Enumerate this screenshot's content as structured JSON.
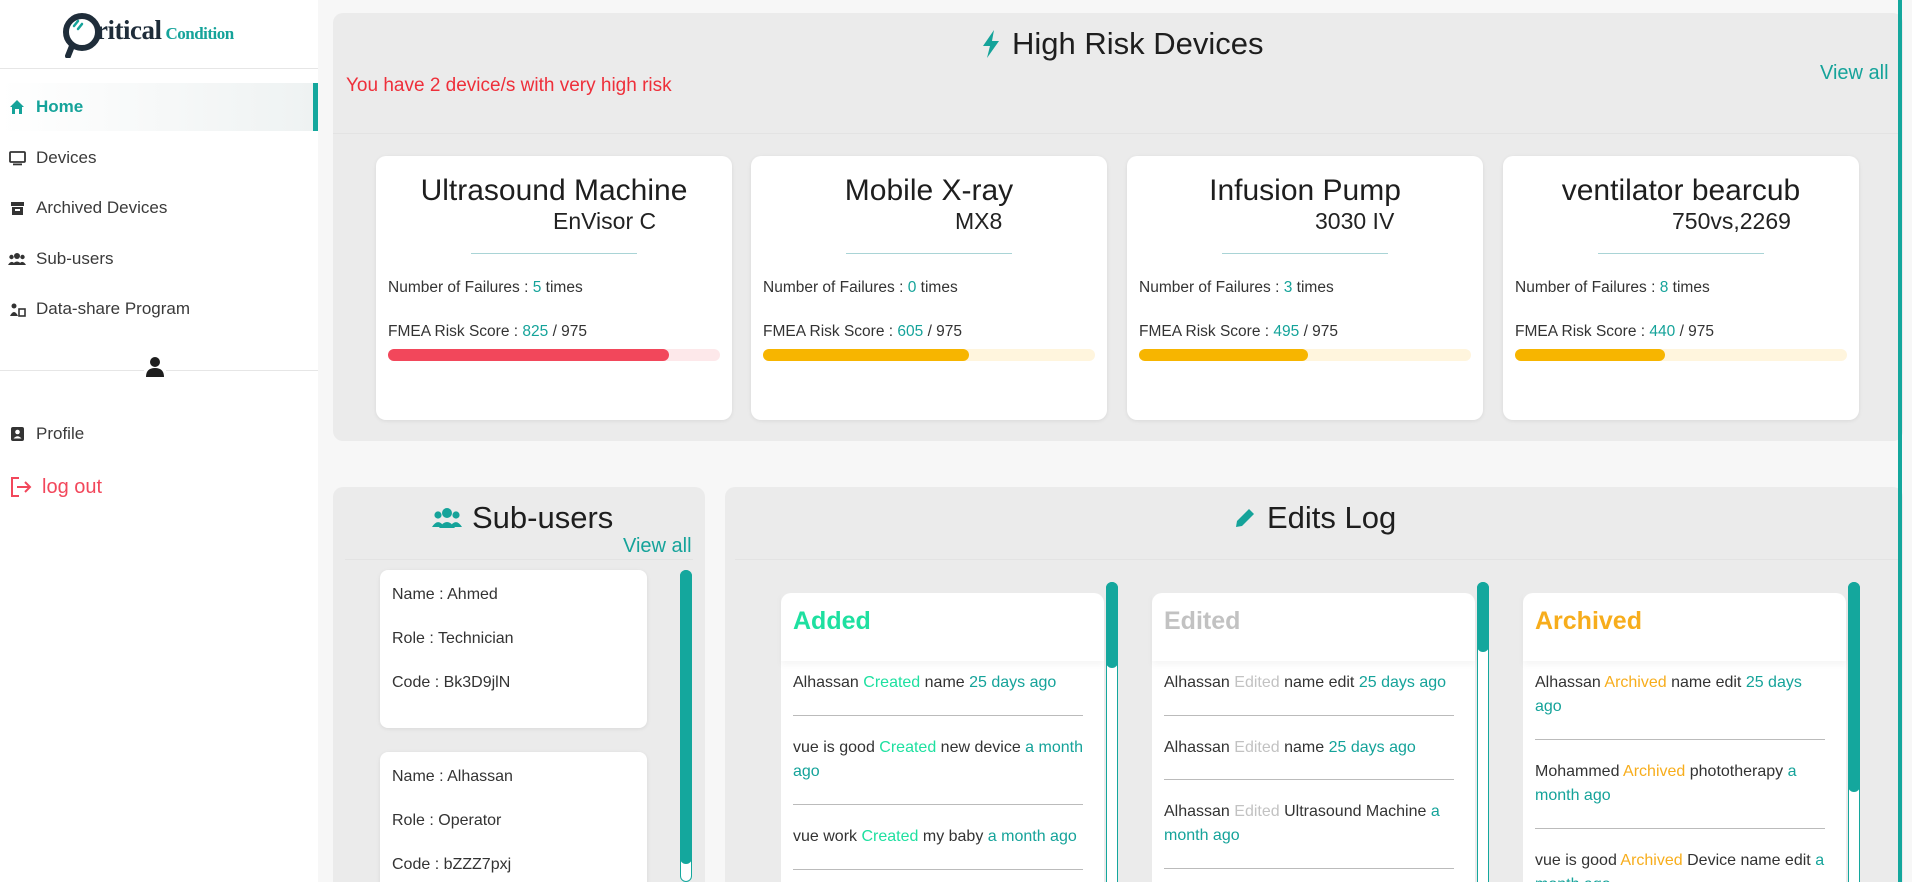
{
  "brand": {
    "name_main": "ritical",
    "name_sub": "Condition"
  },
  "sidebar": {
    "items": [
      {
        "label": "Home",
        "icon": "home-icon"
      },
      {
        "label": "Devices",
        "icon": "monitor-icon"
      },
      {
        "label": "Archived Devices",
        "icon": "archive-icon"
      },
      {
        "label": "Sub-users",
        "icon": "users-icon"
      },
      {
        "label": "Data-share Program",
        "icon": "share-icon"
      }
    ],
    "profile": "Profile",
    "logout": "log out"
  },
  "high_risk": {
    "title": "High Risk Devices",
    "alert": "You have 2 device/s with very high risk",
    "view_all": "View all",
    "failures_label": "Number of Failures : ",
    "times": "times",
    "risk_label": "FMEA Risk Score : ",
    "risk_max": "/ 975",
    "devices": [
      {
        "name": "Ultrasound Machine",
        "model": "EnVisor C",
        "failures": "5",
        "score": "825",
        "fraction": 0.846,
        "color": "#f2475b",
        "track": "#fde8ea"
      },
      {
        "name": "Mobile X-ray",
        "model": "MX8",
        "failures": "0",
        "score": "605",
        "fraction": 0.62,
        "color": "#f7b500",
        "track": "#fff5dd"
      },
      {
        "name": "Infusion Pump",
        "model": "3030 IV",
        "failures": "3",
        "score": "495",
        "fraction": 0.508,
        "color": "#f7b500",
        "track": "#fff5dd"
      },
      {
        "name": "ventilator bearcub",
        "model": "750vs,2269",
        "failures": "8",
        "score": "440",
        "fraction": 0.451,
        "color": "#f7b500",
        "track": "#fff5dd"
      }
    ]
  },
  "subusers": {
    "title": "Sub-users",
    "view_all": "View all",
    "users": [
      {
        "name": "Name : Ahmed",
        "role": "Role : Technician",
        "code": "Code : Bk3D9jlN"
      },
      {
        "name": "Name : Alhassan",
        "role": "Role : Operator",
        "code": "Code : bZZZ7pxj"
      }
    ]
  },
  "edits_log": {
    "title": "Edits Log",
    "columns": [
      {
        "title": "Added",
        "color": "#1ee0a0",
        "entries": [
          {
            "who": "Alhassan",
            "action": "Created",
            "what": "name",
            "when": "25 days ago"
          },
          {
            "who": "vue is good",
            "action": "Created",
            "what": "new device",
            "when": "a month ago"
          },
          {
            "who": "vue work",
            "action": "Created",
            "what": "my baby",
            "when": "a month ago"
          }
        ]
      },
      {
        "title": "Edited",
        "color": "#c2c2c2",
        "entries": [
          {
            "who": "Alhassan",
            "action": "Edited",
            "what": "name edit",
            "when": "25 days ago"
          },
          {
            "who": "Alhassan",
            "action": "Edited",
            "what": "name",
            "when": "25 days ago"
          },
          {
            "who": "Alhassan",
            "action": "Edited",
            "what": "Ultrasound Machine",
            "when": "a month ago"
          }
        ]
      },
      {
        "title": "Archived",
        "color": "#f7ad1c",
        "entries": [
          {
            "who": "Alhassan",
            "action": "Archived",
            "what": "name edit",
            "when": "25 days ago"
          },
          {
            "who": "Mohammed",
            "action": "Archived",
            "what": "phototherapy",
            "when": "a month ago"
          },
          {
            "who": "vue is good",
            "action": "Archived",
            "what": "Device name edit",
            "when": "a month ago"
          }
        ]
      }
    ]
  }
}
